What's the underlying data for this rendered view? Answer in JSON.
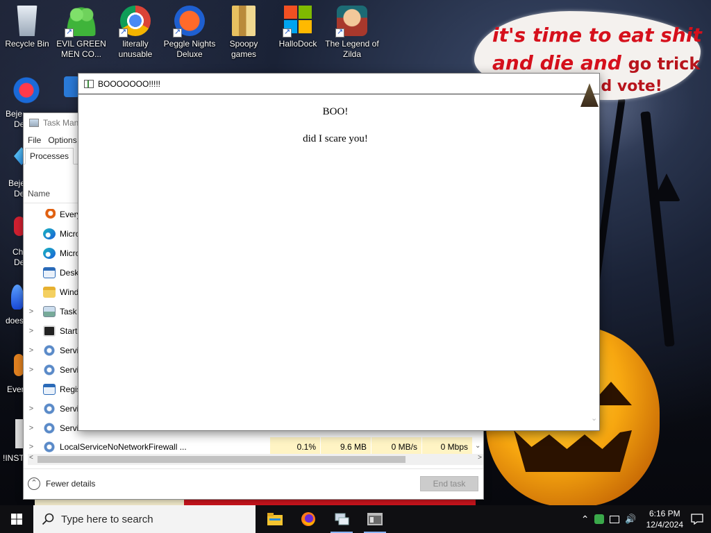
{
  "desktop": {
    "bubble": {
      "line1": "it's time to eat shit",
      "line2a": "and die and",
      "line2b": "go trick",
      "line3": "and vote!"
    },
    "icons": [
      {
        "label": "Recycle Bin",
        "icon": "recycle-bin-icon"
      },
      {
        "label": "EVIL GREEN MEN CO...",
        "icon": "evil-green-men-icon"
      },
      {
        "label": "literally unusable",
        "icon": "chrome-icon"
      },
      {
        "label": "Peggle Nights Deluxe",
        "icon": "peggle-icon"
      },
      {
        "label": "Spoopy games",
        "icon": "folder-icon"
      },
      {
        "label": "HalloDock",
        "icon": "windows-logo-icon"
      },
      {
        "label": "The Legend of Zilda",
        "icon": "zilda-icon"
      }
    ],
    "left_partial_labels": [
      "Beje",
      "De",
      "Beje",
      "De",
      "Ch",
      "De",
      "does",
      "Ever",
      "!INSTA"
    ]
  },
  "task_manager": {
    "title": "Task Man",
    "menu": [
      "File",
      "Options"
    ],
    "tabs": [
      "Processes",
      "P"
    ],
    "column_name": "Name",
    "processes": [
      {
        "name": "Every",
        "expandable": false,
        "icon": "search-icon"
      },
      {
        "name": "Micro",
        "expandable": false,
        "icon": "edge-icon"
      },
      {
        "name": "Micro",
        "expandable": false,
        "icon": "edge-icon"
      },
      {
        "name": "Deskt",
        "expandable": false,
        "icon": "window-icon"
      },
      {
        "name": "Wind",
        "expandable": false,
        "icon": "folder-icon"
      },
      {
        "name": "Task M",
        "expandable": true,
        "icon": "task-manager-icon"
      },
      {
        "name": "Start",
        "expandable": true,
        "icon": "start-icon"
      },
      {
        "name": "Servic",
        "expandable": true,
        "icon": "gear-icon"
      },
      {
        "name": "Servic",
        "expandable": true,
        "icon": "gear-icon"
      },
      {
        "name": "Regis",
        "expandable": false,
        "icon": "window-icon"
      },
      {
        "name": "Servic",
        "expandable": true,
        "icon": "gear-icon"
      },
      {
        "name": "Servic",
        "expandable": true,
        "icon": "gear-icon"
      }
    ],
    "last_row": {
      "name": "LocalServiceNoNetworkFirewall ...",
      "cpu": "0.1%",
      "memory": "9.6 MB",
      "disk": "0 MB/s",
      "network": "0 Mbps"
    },
    "fewer_details": "Fewer details",
    "end_task": "End task"
  },
  "boo_window": {
    "title": "BOOOOOOO!!!!!",
    "heading": "BOO!",
    "message": "did I scare you!"
  },
  "taskbar": {
    "search_placeholder": "Type here to search",
    "time": "6:16 PM",
    "date": "12/4/2024",
    "apps": [
      "file-explorer-icon",
      "firefox-icon",
      "network-app-icon",
      "window-app-icon"
    ]
  }
}
